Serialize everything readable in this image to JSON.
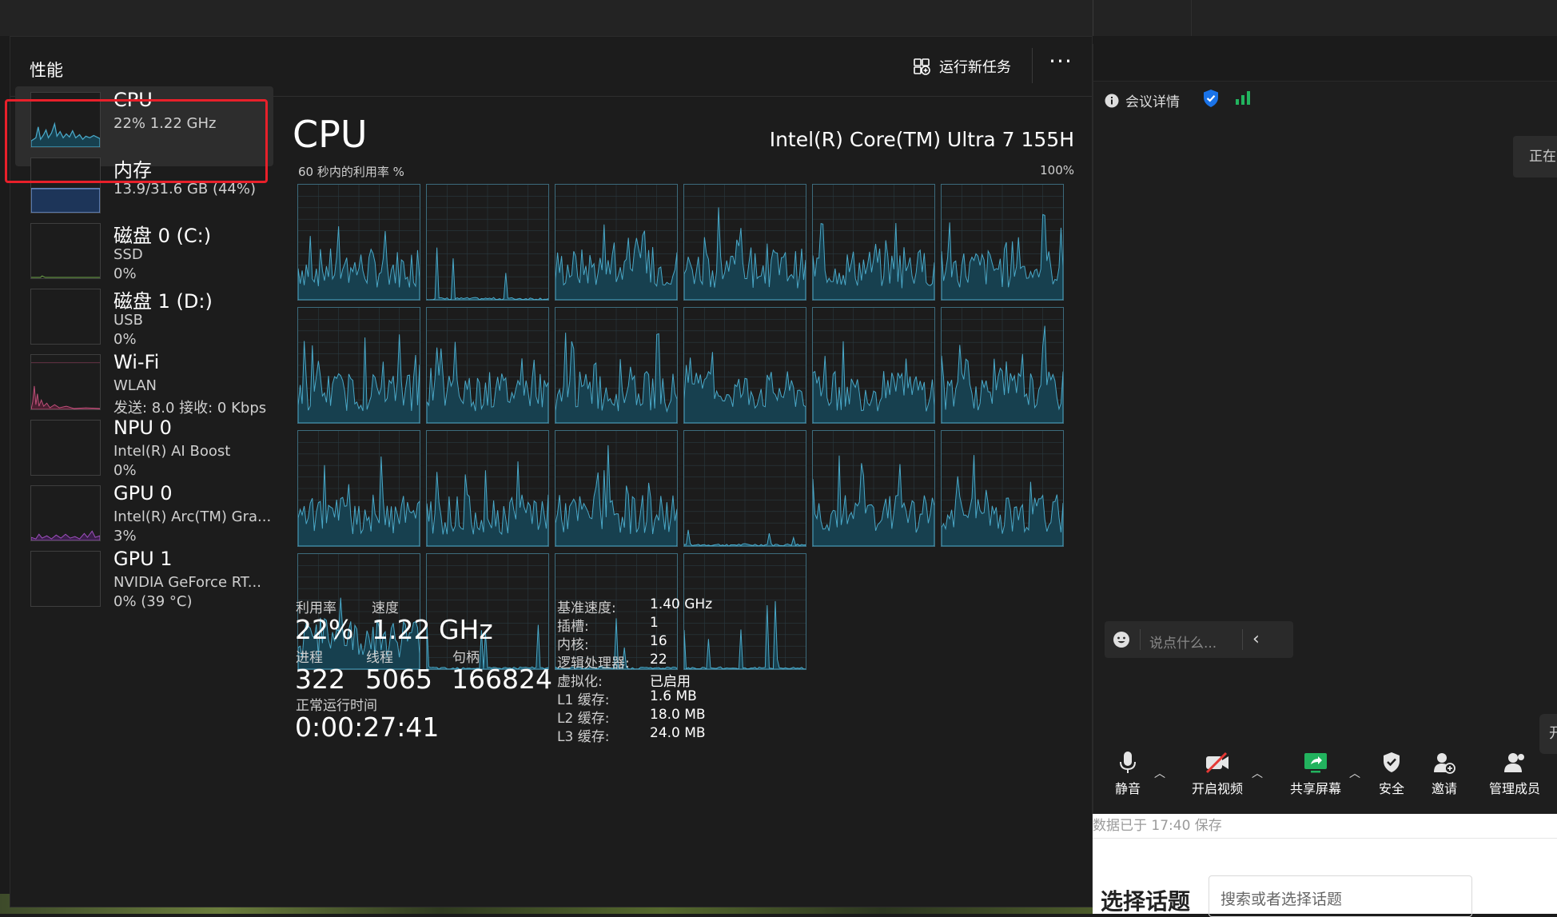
{
  "header": {
    "title": "性能",
    "run_task_label": "运行新任务",
    "more_label": "···"
  },
  "sidebar": {
    "items": [
      {
        "name": "CPU",
        "line1": "22%  1.22 GHz",
        "line2": ""
      },
      {
        "name": "内存",
        "line1": "13.9/31.6 GB (44%)",
        "line2": ""
      },
      {
        "name": "磁盘 0 (C:)",
        "line1": "SSD",
        "line2": "0%"
      },
      {
        "name": "磁盘 1 (D:)",
        "line1": "USB",
        "line2": "0%"
      },
      {
        "name": "Wi-Fi",
        "line1": "WLAN",
        "line2": "发送: 8.0  接收: 0 Kbps"
      },
      {
        "name": "NPU 0",
        "line1": "Intel(R) AI Boost",
        "line2": "0%"
      },
      {
        "name": "GPU 0",
        "line1": "Intel(R) Arc(TM) Gra...",
        "line2": "3%"
      },
      {
        "name": "GPU 1",
        "line1": "NVIDIA GeForce RT...",
        "line2": "0% (39 °C)"
      }
    ]
  },
  "cpu": {
    "title": "CPU",
    "model": "Intel(R) Core(TM) Ultra 7 155H",
    "graph_caption": "60 秒内的利用率 %",
    "graph_max": "100%",
    "core_count_shown": 22,
    "stats": {
      "util_label": "利用率",
      "util_value": "22%",
      "speed_label": "速度",
      "speed_value": "1.22 GHz",
      "proc_label": "进程",
      "proc_value": "322",
      "thread_label": "线程",
      "thread_value": "5065",
      "handle_label": "句柄",
      "handle_value": "166824",
      "uptime_label": "正常运行时间",
      "uptime_value": "0:00:27:41"
    },
    "details": [
      {
        "label": "基准速度:",
        "value": "1.40 GHz"
      },
      {
        "label": "插槽:",
        "value": "1"
      },
      {
        "label": "内核:",
        "value": "16"
      },
      {
        "label": "逻辑处理器:",
        "value": "22"
      },
      {
        "label": "虚拟化:",
        "value": "已启用"
      },
      {
        "label": "L1 缓存:",
        "value": "1.6 MB"
      },
      {
        "label": "L2 缓存:",
        "value": "18.0 MB"
      },
      {
        "label": "L3 缓存:",
        "value": "24.0 MB"
      }
    ]
  },
  "meeting": {
    "info_label": "会议详情",
    "status_partial": "正在",
    "chat_placeholder": "说点什么...",
    "open_partial": "开",
    "toolbar": [
      {
        "label": "静音",
        "icon": "microphone-icon"
      },
      {
        "label": "开启视频",
        "icon": "video-off-icon"
      },
      {
        "label": "共享屏幕",
        "icon": "share-screen-icon"
      },
      {
        "label": "安全",
        "icon": "shield-icon"
      },
      {
        "label": "邀请",
        "icon": "add-user-icon"
      },
      {
        "label": "管理成员",
        "icon": "members-icon"
      }
    ]
  },
  "doc": {
    "saved_text": "数据已于 17:40 保存",
    "topic_label": "选择话题",
    "topic_placeholder": "搜索或者选择话题"
  },
  "colors": {
    "graph_line": "#4aa9c9",
    "graph_fill": "#17404f",
    "memory_line": "#6c8fc9",
    "wifi_line": "#c0507a",
    "gpu_line": "#a050c0",
    "selection_outline": "#e8202a"
  }
}
